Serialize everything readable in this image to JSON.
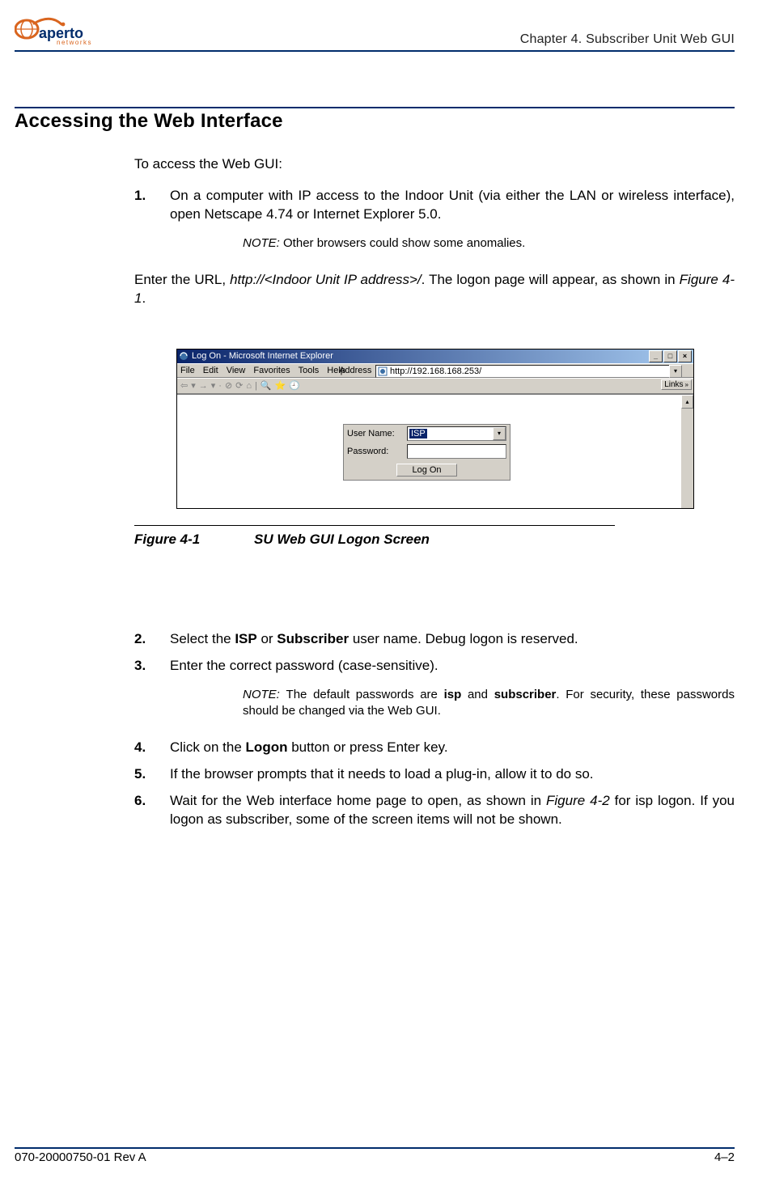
{
  "header": {
    "logo_text": "aperto",
    "logo_sub": "networks",
    "chapter_ref": "Chapter 4.  Subscriber Unit Web GUI"
  },
  "section_title": "Accessing the Web Interface",
  "intro": "To access the Web GUI:",
  "step1": {
    "num": "1.",
    "text": "On a computer with IP access to the Indoor Unit (via either the LAN or wireless interface), open Netscape 4.74 or Internet Explorer 5.0."
  },
  "note1_label": "NOTE:  ",
  "note1_text": "Other browsers could show some anomalies.",
  "enter_url_pre": "Enter the URL, ",
  "enter_url_ital": "http://<Indoor Unit IP address>/",
  "enter_url_post": ". The logon page will appear, as shown in ",
  "enter_url_figref": "Figure 4-1",
  "enter_url_end": ".",
  "browser": {
    "title": "Log On - Microsoft Internet Explorer",
    "menu": [
      "File",
      "Edit",
      "View",
      "Favorites",
      "Tools",
      "Help"
    ],
    "address_label": "Address",
    "address_value": "http://192.168.168.253/",
    "links_label": "Links",
    "login": {
      "username_label": "User Name:",
      "username_value": "ISP",
      "password_label": "Password:",
      "button": "Log On"
    },
    "win_min": "_",
    "win_max": "□",
    "win_close": "×"
  },
  "figure_caption_num": "Figure 4-1",
  "figure_caption_text": "SU Web GUI Logon Screen",
  "step2": {
    "num": "2.",
    "pre": "Select the ",
    "b1": "ISP",
    "mid1": " or ",
    "b2": "Subscriber",
    "mid2": " user name. ",
    "b3": "Debug",
    "post": " logon is reserved."
  },
  "step3": {
    "num": "3.",
    "text": "Enter the correct password (case-sensitive)."
  },
  "note2_label": "NOTE:  ",
  "note2_pre": "The default passwords are ",
  "note2_b1": "isp",
  "note2_mid": " and ",
  "note2_b2": "subscriber",
  "note2_post": ". For security, these passwords should be changed via the Web GUI.",
  "step4": {
    "num": "4.",
    "pre": "Click on the ",
    "b1": "Logon",
    "post": " button or press Enter key."
  },
  "step5": {
    "num": "5.",
    "text": "If the browser prompts that it needs to load a plug-in, allow it to do so."
  },
  "step6": {
    "num": "6.",
    "pre": "Wait for the Web interface home page to open, as shown in ",
    "ital": "Figure 4-2",
    "post": " for isp logon. If you logon as subscriber, some of the screen items will not be shown."
  },
  "footer": {
    "left": "070-20000750-01 Rev A",
    "right": "4–2"
  }
}
